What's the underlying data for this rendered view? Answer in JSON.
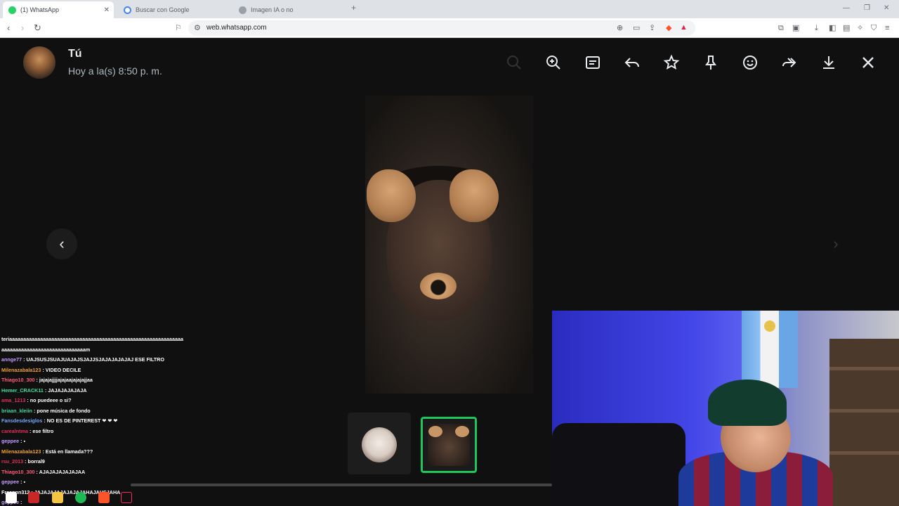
{
  "browser": {
    "tabs": [
      {
        "label": "(1) WhatsApp",
        "active": true,
        "favicon": "whatsapp-icon",
        "color": "#25d366"
      },
      {
        "label": "Buscar con Google",
        "active": false,
        "favicon": "google-icon",
        "color": "#4285f4"
      },
      {
        "label": "Imagen IA o no",
        "active": false,
        "favicon": "globe-icon",
        "color": "#7a7a7a"
      }
    ],
    "new_tab": "+",
    "url": "web.whatsapp.com"
  },
  "viewer": {
    "sender": "Tú",
    "timestamp": "Hoy a la(s) 8:50 p. m.",
    "tools": [
      "zoom-out-icon",
      "zoom-in-icon",
      "caption-icon",
      "reply-icon",
      "star-icon",
      "pin-icon",
      "emoji-icon",
      "forward-icon",
      "download-icon",
      "close-icon"
    ],
    "accent": "#1fc65c"
  },
  "chat": [
    {
      "user": "",
      "text": "teriaaaaaaaaaaaaaaaaaaaaaaaaaaaaaaaaaaaaaaaaaaaaaaaaaaaaaaaaaaaaaa",
      "color": "#ffffff"
    },
    {
      "user": "",
      "text": "aaaaaaaaaaaaaaaaaaaaaaaaaaaaaam",
      "color": "#ffffff"
    },
    {
      "user": "annge77",
      "text": " : UAJSUSJSUAJUAJAJSJAJJSJAJAJAJAJAJ ESE FILTRO",
      "color": "#c59bff"
    },
    {
      "user": "Milenazabala123",
      "text": " : VIDEO DECILE",
      "color": "#f0a030"
    },
    {
      "user": "Thiago10_300",
      "text": " : jajajajjjjajajaajajajajjaa",
      "color": "#ff5a78"
    },
    {
      "user": "Hemer_CRACK11",
      "text": " : JAJAJAJAJAJA",
      "color": "#3ce0a0"
    },
    {
      "user": "ama_1213",
      "text": " : no puedeee o si?",
      "color": "#e0305a"
    },
    {
      "user": "briaan_kleiin",
      "text": " : pone música de fondo",
      "color": "#3cd6a0"
    },
    {
      "user": "Fansdesdesiglos",
      "text": " : NO ES DE PINTEREST ❤ ❤ ❤",
      "color": "#6fa8ff"
    },
    {
      "user": "carealntma",
      "text": " : ese filtro",
      "color": "#e0305a"
    },
    {
      "user": "geppee",
      "text": " : ▪",
      "color": "#c59bff"
    },
    {
      "user": "Milenazabala123",
      "text": " : Está en llamada???",
      "color": "#f0a030"
    },
    {
      "user": "rsu_2013",
      "text": " : borral9",
      "color": "#e0305a"
    },
    {
      "user": "Thiago10_300",
      "text": " : AJAJAJAJAJAJAA",
      "color": "#ff5a78"
    },
    {
      "user": "geppee",
      "text": " : ▪",
      "color": "#c59bff"
    },
    {
      "user": "Fraannn312",
      "text": " : JAJAJAJAJAJAJAJAHAJAHSJAHA",
      "color": "#ffffff"
    },
    {
      "user": "geppee",
      "text": " :",
      "color": "#c59bff"
    }
  ],
  "taskbar": [
    "windows-icon",
    "search-icon",
    "files-icon",
    "spotify-icon",
    "brave-icon",
    "tiktok-icon"
  ]
}
